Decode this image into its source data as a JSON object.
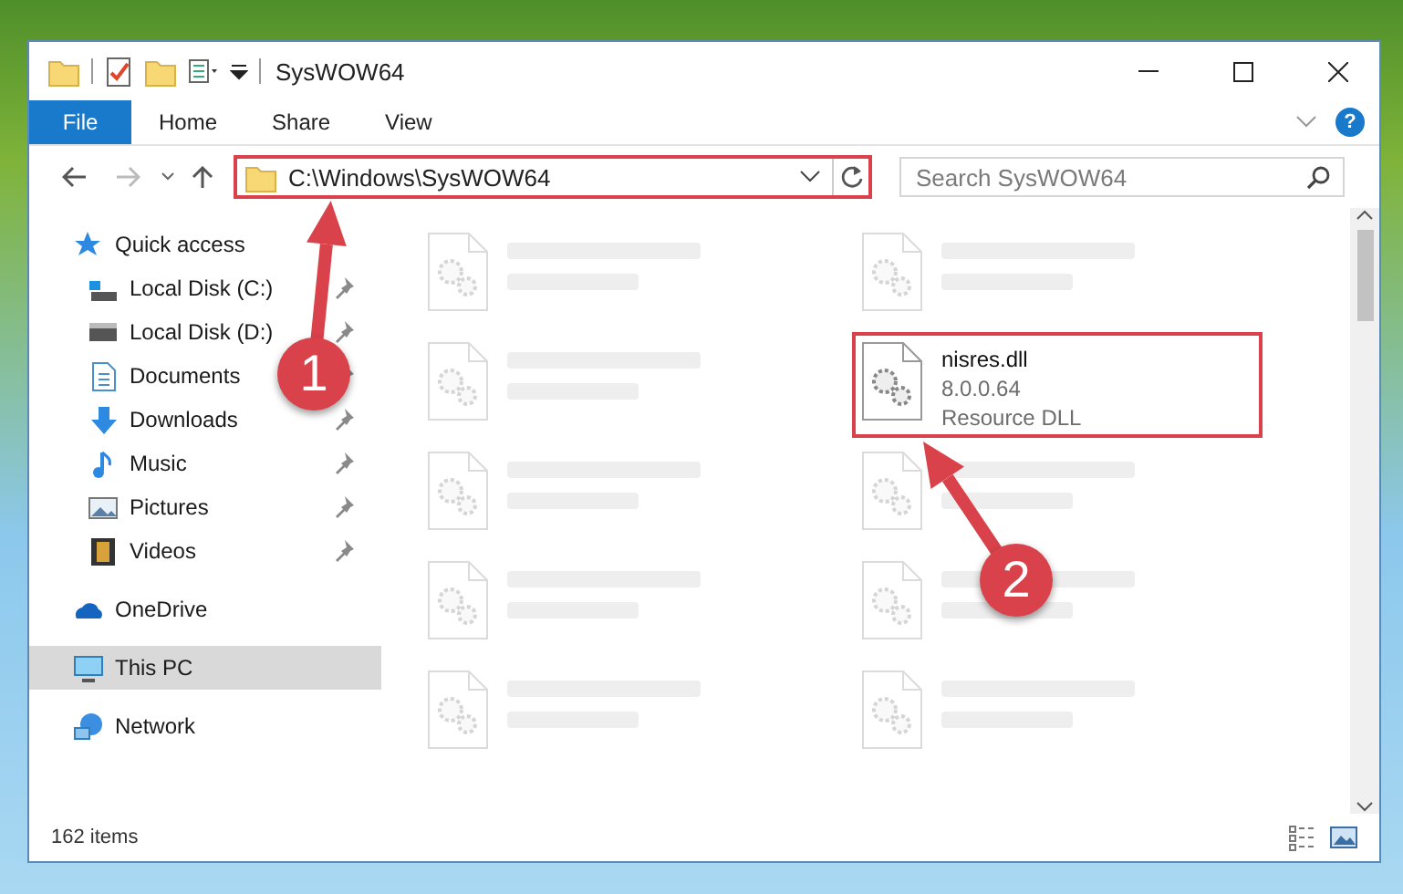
{
  "window": {
    "title": "SysWOW64"
  },
  "ribbon_tabs": [
    {
      "label": "File",
      "selected": true
    },
    {
      "label": "Home",
      "selected": false
    },
    {
      "label": "Share",
      "selected": false
    },
    {
      "label": "View",
      "selected": false
    }
  ],
  "help": {
    "label": "?"
  },
  "address_bar": {
    "path": "C:\\Windows\\SysWOW64",
    "annotated": true
  },
  "search": {
    "placeholder": "Search SysWOW64"
  },
  "navigation": [
    {
      "label": "Quick access",
      "selected": false,
      "children": [
        {
          "label": "Local Disk (C:)",
          "pinned": true
        },
        {
          "label": "Local Disk (D:)",
          "pinned": true
        },
        {
          "label": "Documents",
          "pinned": true
        },
        {
          "label": "Downloads",
          "pinned": true
        },
        {
          "label": "Music",
          "pinned": true
        },
        {
          "label": "Pictures",
          "pinned": true
        },
        {
          "label": "Videos",
          "pinned": true
        }
      ]
    },
    {
      "label": "OneDrive",
      "selected": false
    },
    {
      "label": "This PC",
      "selected": true
    },
    {
      "label": "Network",
      "selected": false
    }
  ],
  "files": [
    {
      "kind": "blurred"
    },
    {
      "kind": "blurred"
    },
    {
      "kind": "blurred"
    },
    {
      "kind": "file",
      "name": "nisres.dll",
      "version": "8.0.0.64",
      "type": "Resource DLL",
      "annotated": true
    },
    {
      "kind": "blurred"
    },
    {
      "kind": "blurred"
    },
    {
      "kind": "blurred"
    },
    {
      "kind": "blurred"
    },
    {
      "kind": "blurred"
    },
    {
      "kind": "blurred"
    }
  ],
  "status_bar": {
    "item_count": "162 items"
  },
  "annotations": [
    {
      "label": "1"
    },
    {
      "label": "2"
    }
  ]
}
